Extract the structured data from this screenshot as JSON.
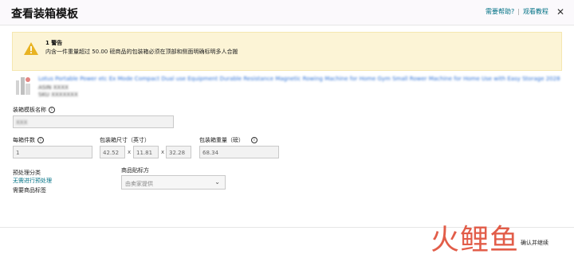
{
  "header": {
    "title": "查看装箱模板",
    "help_link": "需要帮助?",
    "separator": "|",
    "tutorial_link": "观看教程",
    "close_symbol": "✕"
  },
  "warning": {
    "title": "1 警告",
    "message": "内含一件重量超过 50.00 磅商品的包装箱必须在顶部和侧面明确标明多人合搬"
  },
  "product": {
    "title_blurred": "Lotus Portable Power etc Ex Mode Compact Dual use Equipment Durable Resistance Magnetic Rowing Machine for Home Gym Small Rower Machine for Home Use with Easy Storage 2028",
    "meta_line_1": "ASIN XXXX",
    "meta_line_2": "SKU XXXXXXX"
  },
  "form": {
    "template_name_label": "装箱模板名称",
    "template_name_value": "XXX",
    "units_per_box_label": "每箱件数",
    "units_per_box_value": "1",
    "box_dims_label": "包装箱尺寸（英寸）",
    "dim_length": "42.52",
    "dim_width": "11.81",
    "dim_height": "32.28",
    "times_symbol": "x",
    "box_weight_label": "包装箱重量（磅）",
    "box_weight_value": "68.34",
    "prep_category_label": "预处理分类",
    "prep_required_link": "无需进行预处理",
    "labeling_required": "需要商品标签",
    "labeling_owner_label": "商品贴标方",
    "labeling_owner_select": "由卖家提供"
  },
  "footer": {
    "confirm_label": "确认并继续"
  },
  "watermark": {
    "text": "火鲤鱼"
  },
  "colors": {
    "warning_bg": "#fcf4d6",
    "link": "#007185",
    "watermark": "#e0503a"
  }
}
